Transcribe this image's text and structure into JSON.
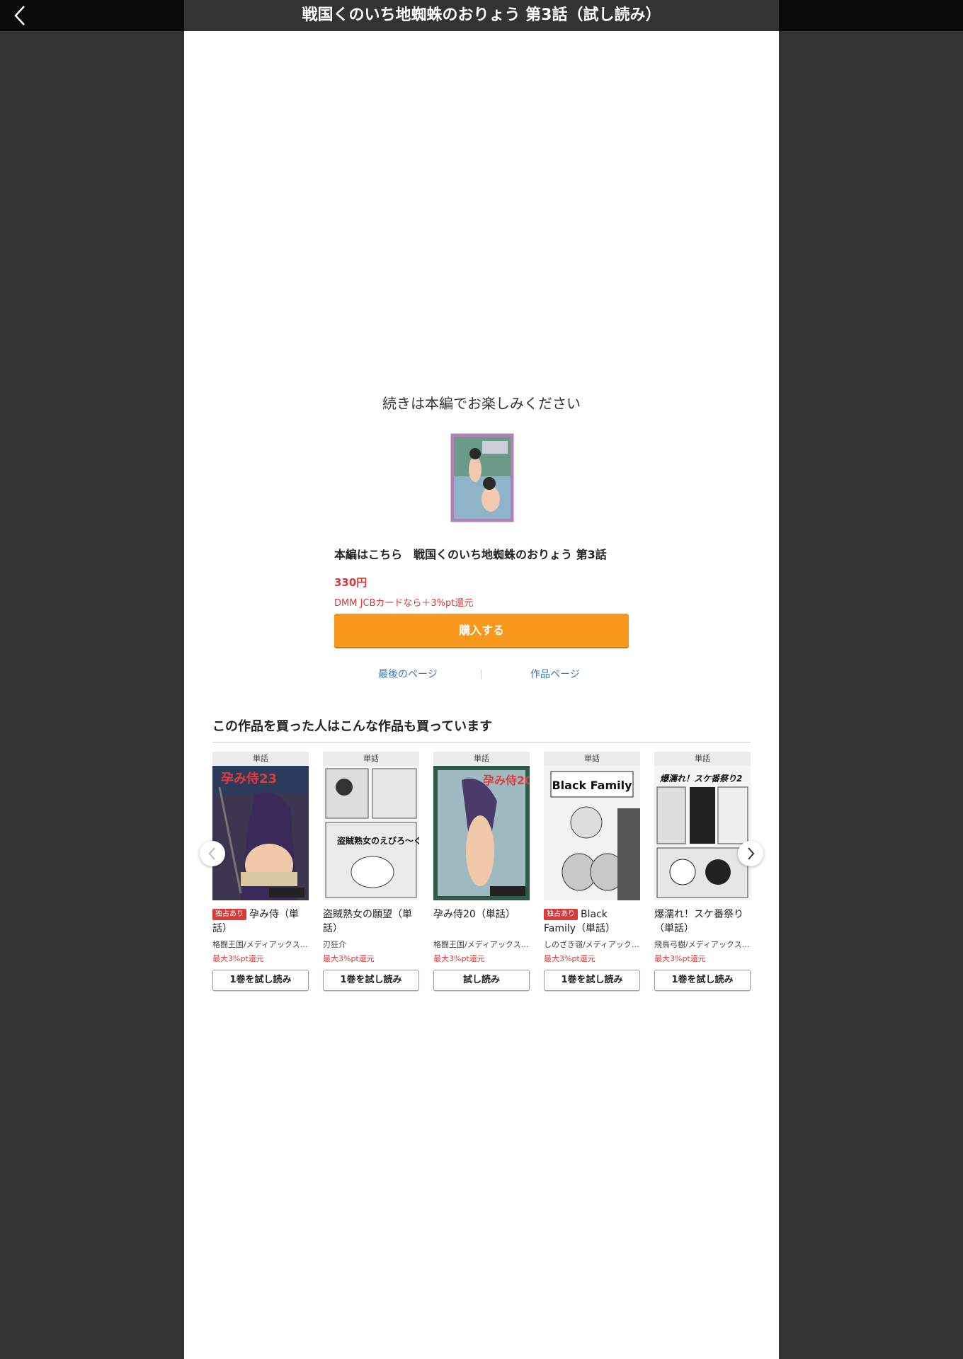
{
  "header": {
    "title": "戦国くのいち地蜘蛛のおりょう 第3話（試し読み）"
  },
  "end": {
    "continue_text": "続きは本編でお楽しみください",
    "product_name": "本編はこちら　戦国くのいち地蜘蛛のおりょう 第3話",
    "price": "330円",
    "point_note": "DMM JCBカードなら＋3%pt還元",
    "buy_label": "購入する",
    "last_page_link": "最後のページ",
    "work_page_link": "作品ページ"
  },
  "recommendations": {
    "title": "この作品を買った人はこんな作品も買っています",
    "items": [
      {
        "type": "単話",
        "badge": "独占あり",
        "title": "孕み侍（単話）",
        "author": "格闘王国/メディアックス…",
        "point": "最大3%pt還元",
        "button": "1巻を試し読み",
        "cover_text": "孕み侍23"
      },
      {
        "type": "単話",
        "badge": "",
        "title": "盗賊熟女の願望（単話）",
        "author": "刃狂介",
        "point": "最大3%pt還元",
        "button": "1巻を試し読み",
        "cover_text": "盗賊熟女のえびろ～ぐ"
      },
      {
        "type": "単話",
        "badge": "",
        "title": "孕み侍20（単話）",
        "author": "格闘王国/メディアックス…",
        "point": "最大3%pt還元",
        "button": "試し読み",
        "cover_text": "孕み侍20"
      },
      {
        "type": "単話",
        "badge": "独占あり",
        "title": "Black Family（単話）",
        "author": "しのざき嶺/メディアック…",
        "point": "最大3%pt還元",
        "button": "1巻を試し読み",
        "cover_text": "Black Family"
      },
      {
        "type": "単話",
        "badge": "",
        "title": "爆濡れ！スケ番祭り（単話）",
        "author": "飛鳥弓樹/メディアックス…",
        "point": "最大3%pt還元",
        "button": "1巻を試し読み",
        "cover_text": "爆濡れ！スケ番祭り2"
      }
    ]
  },
  "colors": {
    "accent": "#f7981d",
    "price_red": "#d63a3a",
    "link_blue": "#3a7ab8",
    "background": "#333333"
  },
  "icons": {
    "back": "chevron-left-icon",
    "prev": "chevron-left-icon",
    "next": "chevron-right-icon"
  }
}
